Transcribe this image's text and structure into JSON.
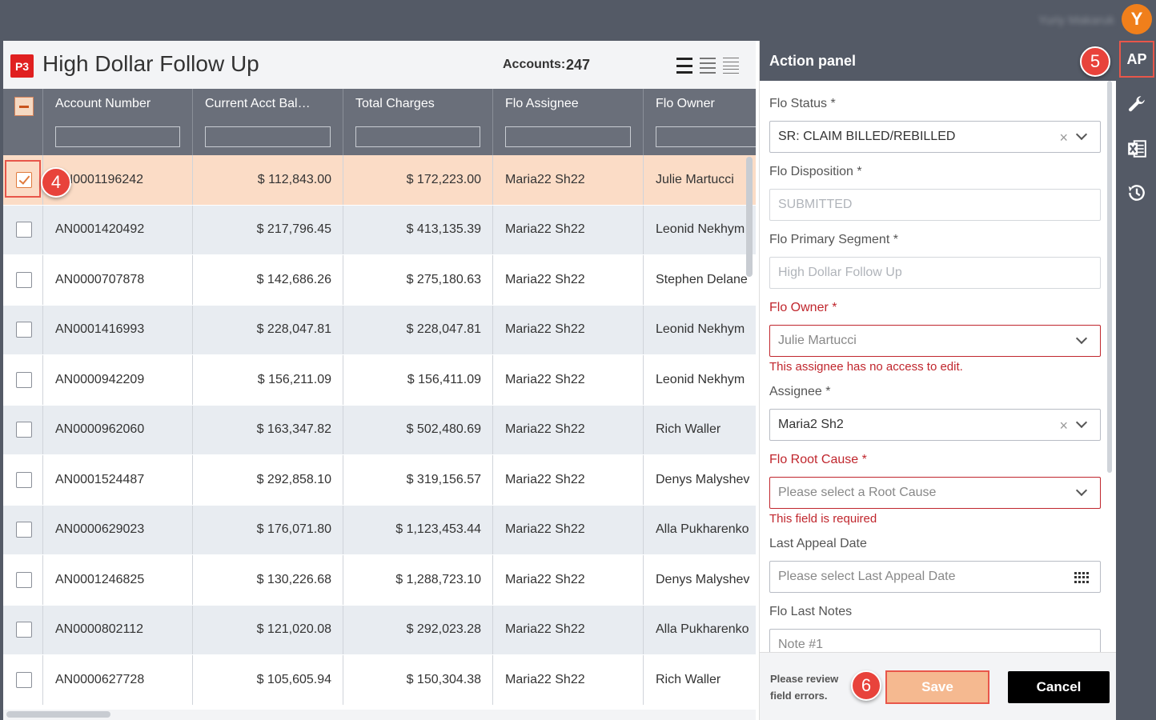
{
  "topbar": {
    "user_name": "Yuriy Makaruk",
    "avatar_letter": "Y"
  },
  "page": {
    "logo": "P3",
    "title": "High Dollar Follow Up",
    "accounts_label": "Accounts:",
    "accounts_value": "247"
  },
  "columns": [
    "Account Number",
    "Current Acct Bal…",
    "Total Charges",
    "Flo Assignee",
    "Flo Owner"
  ],
  "rows": [
    {
      "acct": "AN0001196242",
      "bal": "$ 112,843.00",
      "charges": "$ 172,223.00",
      "assignee": "Maria22 Sh22",
      "owner": "Julie Martucci",
      "checked": true
    },
    {
      "acct": "AN0001420492",
      "bal": "$ 217,796.45",
      "charges": "$ 413,135.39",
      "assignee": "Maria22 Sh22",
      "owner": "Leonid Nekhym"
    },
    {
      "acct": "AN0000707878",
      "bal": "$ 142,686.26",
      "charges": "$ 275,180.63",
      "assignee": "Maria22 Sh22",
      "owner": "Stephen Delane"
    },
    {
      "acct": "AN0001416993",
      "bal": "$ 228,047.81",
      "charges": "$ 228,047.81",
      "assignee": "Maria22 Sh22",
      "owner": "Leonid Nekhym"
    },
    {
      "acct": "AN0000942209",
      "bal": "$ 156,211.09",
      "charges": "$ 156,411.09",
      "assignee": "Maria22 Sh22",
      "owner": "Leonid Nekhym"
    },
    {
      "acct": "AN0000962060",
      "bal": "$ 163,347.82",
      "charges": "$ 502,480.69",
      "assignee": "Maria22 Sh22",
      "owner": "Rich Waller"
    },
    {
      "acct": "AN0001524487",
      "bal": "$ 292,858.10",
      "charges": "$ 319,156.57",
      "assignee": "Maria22 Sh22",
      "owner": "Denys Malyshev"
    },
    {
      "acct": "AN0000629023",
      "bal": "$ 176,071.80",
      "charges": "$ 1,123,453.44",
      "assignee": "Maria22 Sh22",
      "owner": "Alla Pukharenko"
    },
    {
      "acct": "AN0001246825",
      "bal": "$ 130,226.68",
      "charges": "$ 1,288,723.10",
      "assignee": "Maria22 Sh22",
      "owner": "Denys Malyshev"
    },
    {
      "acct": "AN0000802112",
      "bal": "$ 121,020.08",
      "charges": "$ 292,023.28",
      "assignee": "Maria22 Sh22",
      "owner": "Alla Pukharenko"
    },
    {
      "acct": "AN0000627728",
      "bal": "$ 105,605.94",
      "charges": "$ 150,304.38",
      "assignee": "Maria22 Sh22",
      "owner": "Rich Waller"
    }
  ],
  "panel": {
    "title": "Action panel",
    "flo_status": {
      "label": "Flo Status *",
      "value": "SR: CLAIM BILLED/REBILLED"
    },
    "flo_disposition": {
      "label": "Flo Disposition *",
      "value": "SUBMITTED"
    },
    "flo_primary_segment": {
      "label": "Flo Primary Segment *",
      "value": "High Dollar Follow Up"
    },
    "flo_owner": {
      "label": "Flo Owner *",
      "value": "Julie Martucci",
      "error": "This assignee has no access to edit."
    },
    "assignee": {
      "label": "Assignee *",
      "value": "Maria2 Sh2"
    },
    "flo_root_cause": {
      "label": "Flo Root Cause *",
      "placeholder": "Please select a Root Cause",
      "error": "This field is required"
    },
    "last_appeal_date": {
      "label": "Last Appeal Date",
      "placeholder": "Please select Last Appeal Date"
    },
    "flo_last_notes": {
      "label": "Flo Last Notes",
      "placeholder": "Note #1"
    },
    "footer_message": "Please review field errors.",
    "save_label": "Save",
    "cancel_label": "Cancel"
  },
  "rail": {
    "ap_label": "AP",
    "icons": [
      "wrench-icon",
      "excel-icon",
      "history-icon"
    ]
  },
  "markers": {
    "m4": "4",
    "m5": "5",
    "m6": "6"
  },
  "colors": {
    "accent": "#f07f1b",
    "error": "#c0262d",
    "marker": "#e8433b",
    "header_bg": "#545a66"
  }
}
